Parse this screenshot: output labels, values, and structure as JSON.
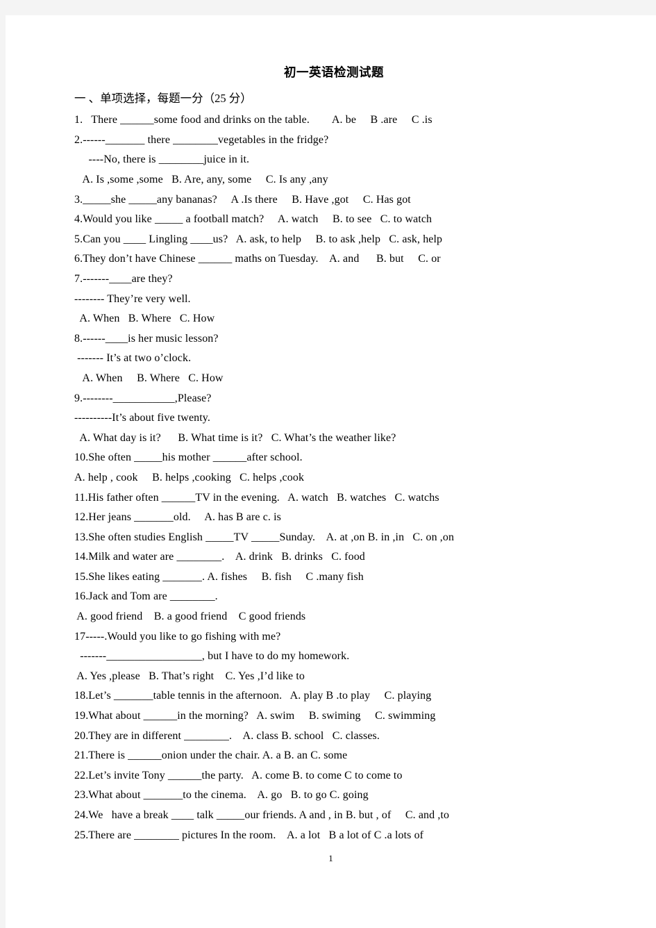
{
  "document": {
    "title": "初一英语检测试题",
    "section_heading": "一 、单项选择，每题一分（25 分）",
    "page_number": "1",
    "lines": [
      "1.   There ______some food and drinks on the table.        A. be     B .are     C .is",
      "2.------_______ there ________vegetables in the fridge?",
      "     ----No, there is ________juice in it.",
      "   A. Is ,some ,some   B. Are, any, some     C. Is any ,any",
      "3._____she _____any bananas?     A .Is there     B. Have ,got     C. Has got",
      "4.Would you like _____ a football match?     A. watch     B. to see   C. to watch",
      "5.Can you ____ Lingling ____us?   A. ask, to help     B. to ask ,help   C. ask, help",
      "6.They don’t have Chinese ______ maths on Tuesday.    A. and      B. but     C. or",
      "7.-------____are they?",
      "-------- They’re very well.",
      "  A. When   B. Where   C. How",
      "8.------____is her music lesson?",
      " ------- It’s at two o’clock.",
      "   A. When     B. Where   C. How",
      "9.--------___________,Please?",
      "----------It’s about five twenty.",
      "  A. What day is it?      B. What time is it?   C. What’s the weather like?",
      "10.She often _____his mother ______after school.",
      "A. help , cook     B. helps ,cooking   C. helps ,cook",
      "11.His father often ______TV in the evening.   A. watch   B. watches   C. watchs",
      "12.Her jeans _______old.     A. has B are c. is",
      "13.She often studies English _____TV _____Sunday.    A. at ,on B. in ,in   C. on ,on",
      "14.Milk and water are ________.    A. drink   B. drinks   C. food",
      "15.She likes eating _______. A. fishes     B. fish     C .many fish",
      "16.Jack and Tom are ________.",
      " A. good friend    B. a good friend    C good friends",
      "17-----.Would you like to go fishing with me?",
      "  -------_________________, but I have to do my homework.",
      " A. Yes ,please   B. That’s right    C. Yes ,I’d like to",
      "18.Let’s _______table tennis in the afternoon.   A. play B .to play     C. playing",
      "19.What about ______in the morning?   A. swim     B. swiming     C. swimming",
      "20.They are in different ________.    A. class B. school   C. classes.",
      "21.There is ______onion under the chair. A. a B. an C. some",
      "22.Let’s invite Tony ______the party.   A. come B. to come C to come to",
      "23.What about _______to the cinema.    A. go   B. to go C. going",
      "24.We   have a break ____ talk _____our friends. A and , in B. but , of     C. and ,to",
      "25.There are ________ pictures In the room.    A. a lot   B a lot of C .a lots of"
    ]
  }
}
